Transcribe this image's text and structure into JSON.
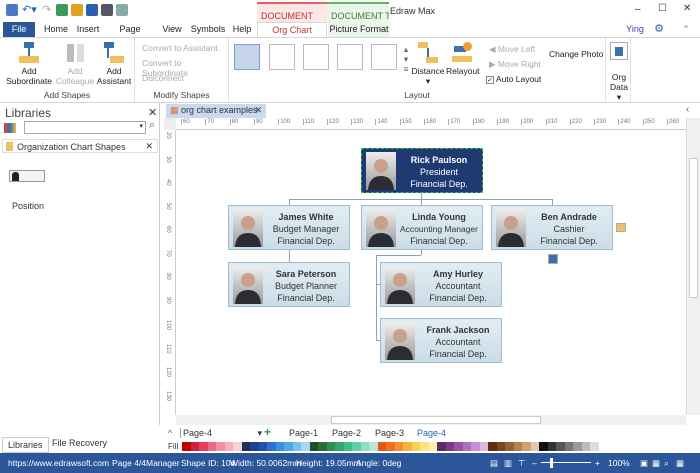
{
  "app": {
    "title": "Edraw Max",
    "user": "Ying",
    "context_tabs": [
      "DOCUMENT TOO...",
      "DOCUMENT T..."
    ]
  },
  "menu_tabs": [
    "File",
    "Home",
    "Insert",
    "Page Layout",
    "View",
    "Symbols",
    "Help",
    "Org Chart",
    "Picture Format"
  ],
  "ribbon": {
    "add_shapes": {
      "label": "Add Shapes",
      "add_subordinate": "Add Subordinate",
      "add_colleague": "Add Colleague",
      "add_assistant": "Add Assistant"
    },
    "modify_shapes": {
      "label": "Modify Shapes",
      "convert_assistant": "Convert to Assistant",
      "convert_subordinate": "Convert to Subordinate",
      "disconnect": "Disconnect"
    },
    "layout": {
      "label": "Layout",
      "distance": "Distance",
      "relayout": "Relayout",
      "move_left": "Move Left",
      "move_right": "Move Right",
      "auto_layout": "Auto Layout",
      "auto_layout_checked": true,
      "change_photo": "Change Photo"
    },
    "org_data": {
      "label1": "Org",
      "label2": "Data"
    }
  },
  "libraries": {
    "title": "Libraries",
    "search_placeholder": "",
    "section": "Organization Chart Shapes",
    "shape_label": "Position",
    "bottom_tabs": [
      "Libraries",
      "File Recovery"
    ]
  },
  "document": {
    "tab": "org chart examples",
    "hruler": [
      "60",
      "70",
      "80",
      "90",
      "100",
      "110",
      "120",
      "130",
      "140",
      "150",
      "160",
      "170",
      "180",
      "190",
      "200",
      "210",
      "220",
      "230",
      "240",
      "250",
      "260"
    ],
    "vruler": [
      "20",
      "30",
      "40",
      "50",
      "60",
      "70",
      "80",
      "90",
      "100",
      "110",
      "120",
      "130"
    ]
  },
  "org": [
    {
      "name": "Rick Paulson",
      "title": "President",
      "dept": "Financial Dep."
    },
    {
      "name": "James White",
      "title": "Budget Manager",
      "dept": "Financial Dep."
    },
    {
      "name": "Linda Young",
      "title": "Accounting Manager",
      "dept": "Financial Dep."
    },
    {
      "name": "Ben Andrade",
      "title": "Cashier",
      "dept": "Financial Dep."
    },
    {
      "name": "Sara Peterson",
      "title": "Budget Planner",
      "dept": "Financial Dep."
    },
    {
      "name": "Amy Hurley",
      "title": "Accountant",
      "dept": "Financial Dep."
    },
    {
      "name": "Frank Jackson",
      "title": "Accountant",
      "dept": "Financial Dep."
    }
  ],
  "pages": {
    "current": "Page-4",
    "tabs": [
      "Page-1",
      "Page-2",
      "Page-3",
      "Page-4"
    ],
    "fill_label": "Fill"
  },
  "palette": [
    "#c00000",
    "#d0223b",
    "#e0405a",
    "#e86b80",
    "#f08fa0",
    "#f4b0bd",
    "#f8d0d8",
    "#1f2f5f",
    "#203f8f",
    "#2050b0",
    "#2f6fd0",
    "#3b8fe0",
    "#55a8e8",
    "#7bc0ee",
    "#a8d6f4",
    "#1e4d2b",
    "#2a6f3a",
    "#2f8f4f",
    "#34a86a",
    "#3cc08a",
    "#5fd0a8",
    "#90dcc0",
    "#b8e8d4",
    "#e05a10",
    "#f07020",
    "#f59030",
    "#f8b040",
    "#fbd050",
    "#fce47a",
    "#fdf0b0",
    "#5a2a6a",
    "#7a3a8a",
    "#9a50aa",
    "#b070c0",
    "#c890d0",
    "#dcb8e4",
    "#5a3010",
    "#7a4520",
    "#9a6030",
    "#b88050",
    "#d0a070",
    "#e4c8a8",
    "#111111",
    "#333333",
    "#555555",
    "#777777",
    "#999999",
    "#bbbbbb",
    "#dddddd"
  ],
  "status": {
    "url": "https://www.edrawsoft.com",
    "page": "Page 4/4",
    "shape": "Manager",
    "shape_id": "Shape ID: 104",
    "width": "Width: 50.0062mm",
    "height": "Height: 19.05mm",
    "angle": "Angle: 0deg",
    "zoom": "100%"
  }
}
